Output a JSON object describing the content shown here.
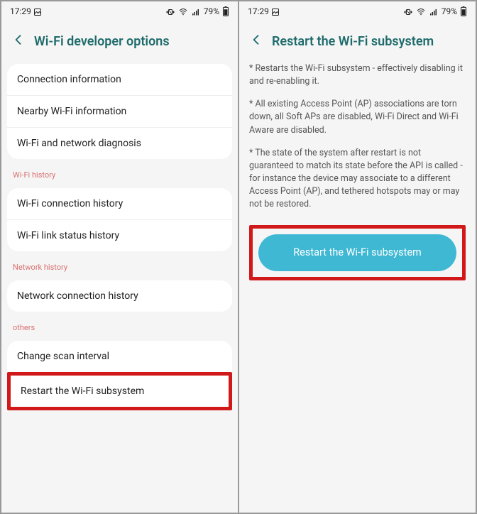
{
  "statusbar": {
    "time": "17:29",
    "battery": "79%"
  },
  "left": {
    "title": "Wi-Fi developer options",
    "group1": {
      "items": [
        "Connection information",
        "Nearby Wi-Fi information",
        "Wi-Fi and network diagnosis"
      ]
    },
    "history_header": "Wi-Fi history",
    "group2": {
      "items": [
        "Wi-Fi connection history",
        "Wi-Fi link status history"
      ]
    },
    "network_header": "Network history",
    "group3": {
      "items": [
        "Network connection history"
      ]
    },
    "others_header": "others",
    "group4": {
      "change_scan": "Change scan interval",
      "restart": "Restart the Wi-Fi subsystem"
    }
  },
  "right": {
    "title": "Restart the Wi-Fi subsystem",
    "p1": "* Restarts the Wi-Fi subsystem - effectively disabling it and re-enabling it.",
    "p2": "* All existing Access Point (AP) associations are torn down, all Soft APs are disabled, Wi-Fi Direct and Wi-Fi Aware are disabled.",
    "p3": "* The state of the system after restart is not guaranteed to match its state before the API is called - for instance the device may associate to a different Access Point (AP), and tethered hotspots may or may not be restored.",
    "button": "Restart the Wi-Fi subsystem"
  }
}
